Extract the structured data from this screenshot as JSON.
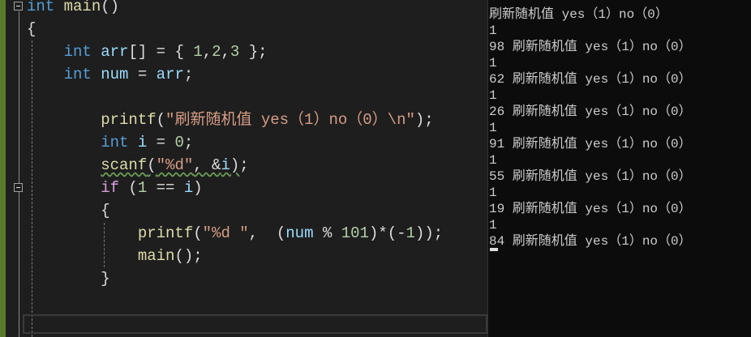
{
  "code_lines": [
    [
      [
        "kw",
        "int"
      ],
      [
        "p",
        " "
      ],
      [
        "fn",
        "main"
      ],
      [
        "p",
        "()"
      ]
    ],
    [
      [
        "p",
        "{"
      ]
    ],
    [
      [
        "p",
        "    "
      ],
      [
        "kw",
        "int"
      ],
      [
        "p",
        " "
      ],
      [
        "var",
        "arr"
      ],
      [
        "p",
        "[] = { "
      ],
      [
        "num",
        "1"
      ],
      [
        "p",
        ","
      ],
      [
        "num",
        "2"
      ],
      [
        "p",
        ","
      ],
      [
        "num",
        "3"
      ],
      [
        "p",
        " };"
      ]
    ],
    [
      [
        "p",
        "    "
      ],
      [
        "kw",
        "int"
      ],
      [
        "p",
        " "
      ],
      [
        "var",
        "num"
      ],
      [
        "p",
        " = "
      ],
      [
        "var",
        "arr"
      ],
      [
        "p",
        ";"
      ]
    ],
    [
      [
        "p",
        ""
      ]
    ],
    [
      [
        "p",
        "        "
      ],
      [
        "fn",
        "printf"
      ],
      [
        "p",
        "("
      ],
      [
        "str",
        "\"刷新随机值 yes（1）no（0）\\n\""
      ],
      [
        "p",
        ");"
      ]
    ],
    [
      [
        "p",
        "        "
      ],
      [
        "kw",
        "int"
      ],
      [
        "p",
        " "
      ],
      [
        "var",
        "i"
      ],
      [
        "p",
        " = "
      ],
      [
        "num",
        "0"
      ],
      [
        "p",
        ";"
      ]
    ],
    [
      [
        "p",
        "        "
      ],
      [
        "fn squig",
        "scanf"
      ],
      [
        "p squig",
        "("
      ],
      [
        "str squig",
        "\"%d\""
      ],
      [
        "p squig",
        ", &"
      ],
      [
        "var squig",
        "i"
      ],
      [
        "p squig",
        ")"
      ],
      [
        "p",
        ";"
      ]
    ],
    [
      [
        "p",
        "        "
      ],
      [
        "kw2",
        "if"
      ],
      [
        "p",
        " ("
      ],
      [
        "num",
        "1"
      ],
      [
        "p",
        " == "
      ],
      [
        "var",
        "i"
      ],
      [
        "p",
        ")"
      ]
    ],
    [
      [
        "p",
        "        {"
      ]
    ],
    [
      [
        "p",
        "            "
      ],
      [
        "fn",
        "printf"
      ],
      [
        "p",
        "("
      ],
      [
        "str",
        "\"%d \""
      ],
      [
        "p",
        ",  ("
      ],
      [
        "var",
        "num"
      ],
      [
        "p",
        " % "
      ],
      [
        "num",
        "101"
      ],
      [
        "p",
        ")*(-"
      ],
      [
        "num",
        "1"
      ],
      [
        "p",
        "));"
      ]
    ],
    [
      [
        "p",
        "            "
      ],
      [
        "fn",
        "main"
      ],
      [
        "p",
        "();"
      ]
    ],
    [
      [
        "p",
        "        }"
      ]
    ]
  ],
  "console_lines": [
    "刷新随机值 yes（1）no（0）",
    "1",
    "98 刷新随机值 yes（1）no（0）",
    "1",
    "62 刷新随机值 yes（1）no（0）",
    "1",
    "26 刷新随机值 yes（1）no（0）",
    "1",
    "91 刷新随机值 yes（1）no（0）",
    "1",
    "55 刷新随机值 yes（1）no（0）",
    "1",
    "19 刷新随机值 yes（1）no（0）",
    "1",
    "84 刷新随机值 yes（1）no（0）"
  ]
}
